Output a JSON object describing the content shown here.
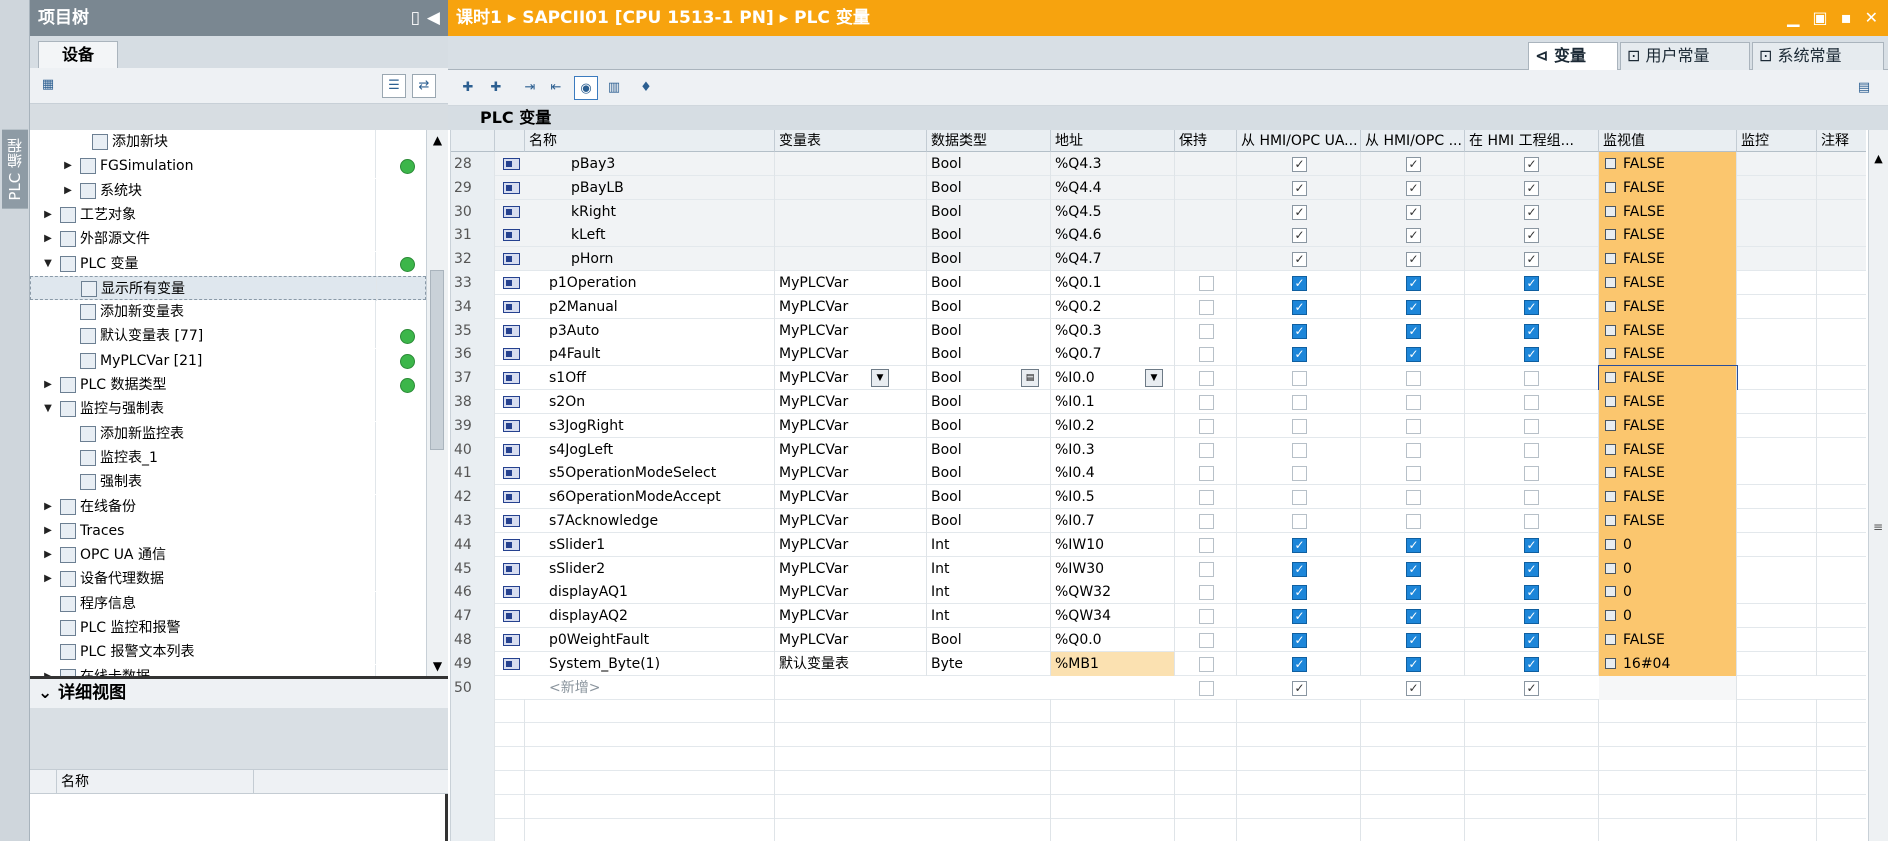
{
  "sidebar_vertical_tab": "PLC 编程",
  "project_tree": {
    "title": "项目树",
    "tab": "设备",
    "items": [
      {
        "label": "添加新块",
        "expand": "",
        "status": false
      },
      {
        "label": "FGSimulation",
        "expand": "▶",
        "status": true
      },
      {
        "label": "系统块",
        "expand": "▶",
        "status": false
      },
      {
        "label": "工艺对象",
        "expand": "▶",
        "status": false
      },
      {
        "label": "外部源文件",
        "expand": "▶",
        "status": false
      },
      {
        "label": "PLC 变量",
        "expand": "▼",
        "status": true
      },
      {
        "label": "显示所有变量",
        "expand": "",
        "status": false,
        "selected": true
      },
      {
        "label": "添加新变量表",
        "expand": "",
        "status": false
      },
      {
        "label": "默认变量表 [77]",
        "expand": "",
        "status": true
      },
      {
        "label": "MyPLCVar [21]",
        "expand": "",
        "status": true
      },
      {
        "label": "PLC 数据类型",
        "expand": "▶",
        "status": true
      },
      {
        "label": "监控与强制表",
        "expand": "▼",
        "status": false
      },
      {
        "label": "添加新监控表",
        "expand": "",
        "status": false
      },
      {
        "label": "监控表_1",
        "expand": "",
        "status": false
      },
      {
        "label": "强制表",
        "expand": "",
        "status": false
      },
      {
        "label": "在线备份",
        "expand": "▶",
        "status": false
      },
      {
        "label": "Traces",
        "expand": "▶",
        "status": false
      },
      {
        "label": "OPC UA 通信",
        "expand": "▶",
        "status": false
      },
      {
        "label": "设备代理数据",
        "expand": "▶",
        "status": false
      },
      {
        "label": "程序信息",
        "expand": "",
        "status": false
      },
      {
        "label": "PLC 监控和报警",
        "expand": "",
        "status": false
      },
      {
        "label": "PLC 报警文本列表",
        "expand": "",
        "status": false
      },
      {
        "label": "在线卡数据",
        "expand": "▶",
        "status": false
      }
    ]
  },
  "details_view": {
    "title": "详细视图",
    "column_name": "名称"
  },
  "main": {
    "breadcrumb": "课时1 ▸ SAPCII01 [CPU 1513-1 PN] ▸ PLC 变量",
    "window_buttons": "▁ ▣ ▪ ✕",
    "tabs": [
      "变量",
      "用户常量",
      "系统常量"
    ],
    "page_title": "PLC 变量",
    "columns": [
      "名称",
      "变量表",
      "数据类型",
      "地址",
      "保持",
      "从 HMI/OPC UA...",
      "从 HMI/OPC ...",
      "在 HMI 工程组...",
      "监视值",
      "监控",
      "注释"
    ],
    "new_row_label": "<新增>",
    "new_row_number": "50",
    "rows": [
      {
        "n": "28",
        "name": "pBay3",
        "table": "",
        "type": "Bool",
        "addr": "%Q4.3",
        "mon": "FALSE",
        "ro": true,
        "blue": false
      },
      {
        "n": "29",
        "name": "pBayLB",
        "table": "",
        "type": "Bool",
        "addr": "%Q4.4",
        "mon": "FALSE",
        "ro": true,
        "blue": false
      },
      {
        "n": "30",
        "name": "kRight",
        "table": "",
        "type": "Bool",
        "addr": "%Q4.5",
        "mon": "FALSE",
        "ro": true,
        "blue": false
      },
      {
        "n": "31",
        "name": "kLeft",
        "table": "",
        "type": "Bool",
        "addr": "%Q4.6",
        "mon": "FALSE",
        "ro": true,
        "blue": false
      },
      {
        "n": "32",
        "name": "pHorn",
        "table": "",
        "type": "Bool",
        "addr": "%Q4.7",
        "mon": "FALSE",
        "ro": true,
        "blue": false
      },
      {
        "n": "33",
        "name": "p1Operation",
        "table": "MyPLCVar",
        "type": "Bool",
        "addr": "%Q0.1",
        "mon": "FALSE",
        "ro": false,
        "blue": true
      },
      {
        "n": "34",
        "name": "p2Manual",
        "table": "MyPLCVar",
        "type": "Bool",
        "addr": "%Q0.2",
        "mon": "FALSE",
        "ro": false,
        "blue": true
      },
      {
        "n": "35",
        "name": "p3Auto",
        "table": "MyPLCVar",
        "type": "Bool",
        "addr": "%Q0.3",
        "mon": "FALSE",
        "ro": false,
        "blue": true
      },
      {
        "n": "36",
        "name": "p4Fault",
        "table": "MyPLCVar",
        "type": "Bool",
        "addr": "%Q0.7",
        "mon": "FALSE",
        "ro": false,
        "blue": true
      },
      {
        "n": "37",
        "name": "s1Off",
        "table": "MyPLCVar",
        "type": "Bool",
        "addr": "%I0.0",
        "mon": "FALSE",
        "ro": false,
        "blue": false,
        "active": true
      },
      {
        "n": "38",
        "name": "s2On",
        "table": "MyPLCVar",
        "type": "Bool",
        "addr": "%I0.1",
        "mon": "FALSE",
        "ro": false,
        "blue": false
      },
      {
        "n": "39",
        "name": "s3JogRight",
        "table": "MyPLCVar",
        "type": "Bool",
        "addr": "%I0.2",
        "mon": "FALSE",
        "ro": false,
        "blue": false
      },
      {
        "n": "40",
        "name": "s4JogLeft",
        "table": "MyPLCVar",
        "type": "Bool",
        "addr": "%I0.3",
        "mon": "FALSE",
        "ro": false,
        "blue": false
      },
      {
        "n": "41",
        "name": "s5OperationModeSelect",
        "table": "MyPLCVar",
        "type": "Bool",
        "addr": "%I0.4",
        "mon": "FALSE",
        "ro": false,
        "blue": false
      },
      {
        "n": "42",
        "name": "s6OperationModeAccept",
        "table": "MyPLCVar",
        "type": "Bool",
        "addr": "%I0.5",
        "mon": "FALSE",
        "ro": false,
        "blue": false
      },
      {
        "n": "43",
        "name": "s7Acknowledge",
        "table": "MyPLCVar",
        "type": "Bool",
        "addr": "%I0.7",
        "mon": "FALSE",
        "ro": false,
        "blue": false
      },
      {
        "n": "44",
        "name": "sSlider1",
        "table": "MyPLCVar",
        "type": "Int",
        "addr": "%IW10",
        "mon": "0",
        "ro": false,
        "blue": true
      },
      {
        "n": "45",
        "name": "sSlider2",
        "table": "MyPLCVar",
        "type": "Int",
        "addr": "%IW30",
        "mon": "0",
        "ro": false,
        "blue": true
      },
      {
        "n": "46",
        "name": "displayAQ1",
        "table": "MyPLCVar",
        "type": "Int",
        "addr": "%QW32",
        "mon": "0",
        "ro": false,
        "blue": true
      },
      {
        "n": "47",
        "name": "displayAQ2",
        "table": "MyPLCVar",
        "type": "Int",
        "addr": "%QW34",
        "mon": "0",
        "ro": false,
        "blue": true
      },
      {
        "n": "48",
        "name": "p0WeightFault",
        "table": "MyPLCVar",
        "type": "Bool",
        "addr": "%Q0.0",
        "mon": "FALSE",
        "ro": false,
        "blue": true
      },
      {
        "n": "49",
        "name": "System_Byte(1)",
        "table": "默认变量表",
        "type": "Byte",
        "addr": "%MB1",
        "mon": "16#04",
        "ro": false,
        "blue": true,
        "addr_hl": true
      }
    ]
  },
  "colors": {
    "title_orange": "#f7a30e",
    "monitor_orange": "#fbc66e",
    "status_green": "#3cb64a",
    "checkbox_blue": "#1d86d9"
  }
}
